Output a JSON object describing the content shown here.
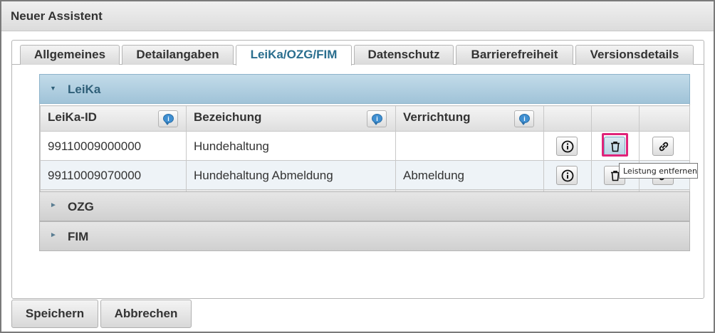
{
  "window": {
    "title": "Neuer Assistent"
  },
  "tabs": [
    {
      "label": "Allgemeines"
    },
    {
      "label": "Detailangaben"
    },
    {
      "label": "LeiKa/OZG/FIM",
      "active": true
    },
    {
      "label": "Datenschutz"
    },
    {
      "label": "Barrierefreiheit"
    },
    {
      "label": "Versionsdetails"
    }
  ],
  "accordion": {
    "leika": {
      "label": "LeiKa",
      "expanded": true
    },
    "ozg": {
      "label": "OZG",
      "expanded": false
    },
    "fim": {
      "label": "FIM",
      "expanded": false
    }
  },
  "grid": {
    "columns": [
      {
        "label": "LeiKa-ID",
        "help_icon": "speech-bubble-info-icon"
      },
      {
        "label": "Bezeichung",
        "help_icon": "speech-bubble-info-icon"
      },
      {
        "label": "Verrichtung",
        "help_icon": "speech-bubble-info-icon"
      }
    ],
    "rows": [
      {
        "id": "99110009000000",
        "bezeichnung": "Hundehaltung",
        "verrichtung": ""
      },
      {
        "id": "99110009070000",
        "bezeichnung": "Hundehaltung Abmeldung",
        "verrichtung": "Abmeldung"
      }
    ],
    "row_actions": [
      "info-icon",
      "trash-icon",
      "link-icon"
    ],
    "add_icon": "plus-icon"
  },
  "tooltip": {
    "text": "Leistung entfernen"
  },
  "footer": {
    "save_label": "Speichern",
    "cancel_label": "Abbrechen"
  },
  "colors": {
    "highlight": "#e0247a",
    "active_tab_text": "#2a6e8e",
    "accordion_active": "#a0c3d8"
  }
}
